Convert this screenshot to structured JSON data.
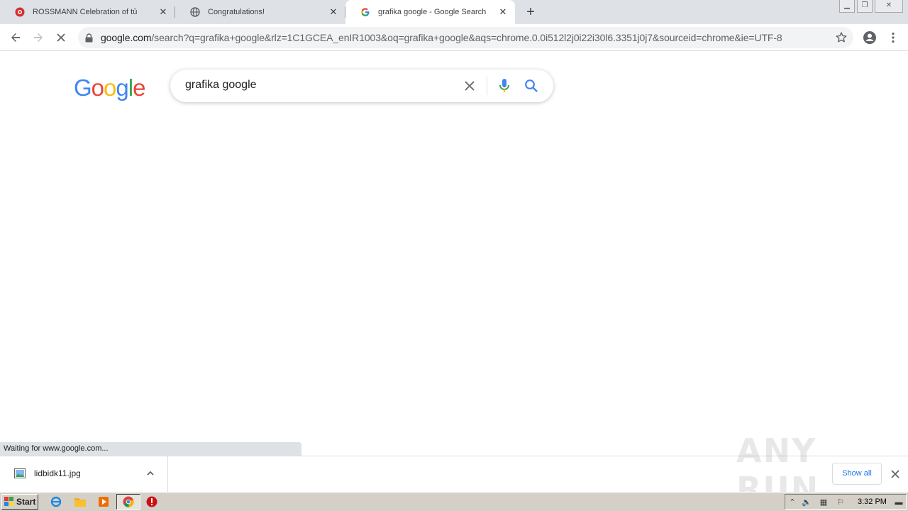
{
  "browser": {
    "tabs": [
      {
        "title": "ROSSMANN Celebration of tû",
        "icon": "rossmann-favicon"
      },
      {
        "title": "Congratulations!",
        "icon": "globe-icon"
      },
      {
        "title": "grafika google - Google Search",
        "icon": "google-favicon"
      }
    ],
    "new_tab_label": "+",
    "address": {
      "host": "google.com",
      "path": "/search?q=grafika+google&rlz=1C1GCEA_enIR1003&oq=grafika+google&aqs=chrome.0.0i512l2j0i22i30l6.3351j0j7&sourceid=chrome&ie=UTF-8"
    },
    "status_text": "Waiting for www.google.com..."
  },
  "page": {
    "logo": [
      "G",
      "o",
      "o",
      "g",
      "l",
      "e"
    ],
    "logo_colors": [
      "#4285f4",
      "#ea4335",
      "#fbbc05",
      "#4285f4",
      "#34a853",
      "#ea4335"
    ],
    "search_query": "grafika google"
  },
  "downloads": {
    "file_name": "lidbidk11.jpg",
    "show_all_label": "Show all"
  },
  "watermark": "ANY RUN",
  "taskbar": {
    "start_label": "Start",
    "clock": "3:32 PM"
  }
}
